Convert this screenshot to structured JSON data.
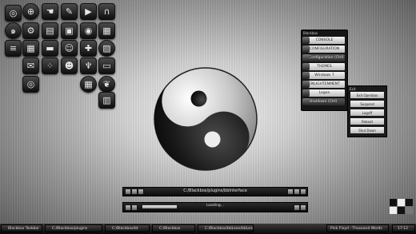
{
  "desktop_icons": [
    {
      "name": "browser-globe-icon",
      "glyph": "◎"
    },
    {
      "name": "network-globe-icon",
      "glyph": "⊕"
    },
    {
      "name": "finder-icon",
      "glyph": "☚"
    },
    {
      "name": "pencil-icon",
      "glyph": "✎"
    },
    {
      "name": "video-icon",
      "glyph": "▶"
    },
    {
      "name": "headphones-icon",
      "glyph": "∩"
    },
    {
      "name": "swirl-icon",
      "glyph": "๑"
    },
    {
      "name": "settings-icon",
      "glyph": "⚙"
    },
    {
      "name": "notes-icon",
      "glyph": "▤"
    },
    {
      "name": "image-icon",
      "glyph": "▣"
    },
    {
      "name": "camera-icon",
      "glyph": "◉"
    },
    {
      "name": "document-icon",
      "glyph": "▦"
    },
    {
      "name": "sliders-icon",
      "glyph": "≡"
    },
    {
      "name": "grid-icon",
      "glyph": "▦"
    },
    {
      "name": "filmstrip-icon",
      "glyph": "▬"
    },
    {
      "name": "people-icon",
      "glyph": "☺"
    },
    {
      "name": "gamepad-icon",
      "glyph": "✚"
    },
    {
      "name": "photo-icon",
      "glyph": "▨"
    },
    {
      "name": "mail-icon",
      "glyph": "✉"
    },
    {
      "name": "dots-icon",
      "glyph": "⁘"
    },
    {
      "name": "contacts-icon",
      "glyph": "☻"
    },
    {
      "name": "microphone-icon",
      "glyph": "♆"
    },
    {
      "name": "terminal-icon",
      "glyph": "▭"
    },
    {
      "name": "camera-lens-icon",
      "glyph": "◎"
    },
    {
      "name": "calculator-icon",
      "glyph": "▦"
    },
    {
      "name": "leaf-icon",
      "glyph": "❦"
    },
    {
      "name": "equalizer-icon",
      "glyph": "▥"
    }
  ],
  "blackbox_menu": {
    "title": "Blackbox",
    "items": [
      "CONSOLE",
      "CONFIGURATION",
      "Configuration (Ctrl)",
      "THEMES",
      "Windows 7",
      "ENLIGHTENMENT",
      "Logon",
      "Shutdown (Ctrl)"
    ]
  },
  "exit_menu": {
    "title": "Exit",
    "items": [
      "Exit Openbox",
      "Suspend",
      "Logoff",
      "Reboot",
      "Shut Down"
    ]
  },
  "dock": {
    "path": "C:/Blackbox/plugins/bbInterface",
    "status": "Loading...",
    "progress": 0.23
  },
  "taskbar": {
    "tasks": [
      "Blackbox Taskbar",
      "C:/Blackbox/plugins",
      "C:/Blackbox/bt",
      "C:/Blackbox",
      "C:/Blackbox/bbLean/bbLean"
    ],
    "track": "Pink Floyd - Thousand Words",
    "clock": "17:12"
  }
}
